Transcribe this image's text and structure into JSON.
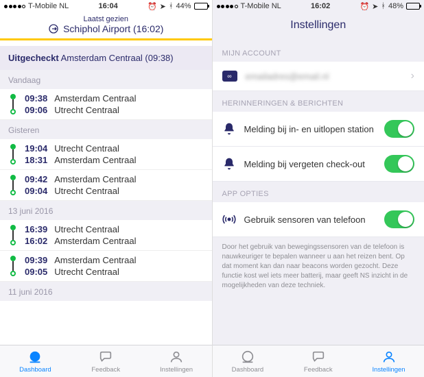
{
  "left": {
    "statusbar": {
      "carrier": "T-Mobile NL",
      "time": "16:04",
      "battery_pct": "44%",
      "battery_fill": 44
    },
    "header_label": "Laatst gezien",
    "header_location": "Schiphol Airport (16:02)",
    "status_badge": "Uitgecheckt",
    "status_text": "Amsterdam Centraal (09:38)",
    "sections": [
      {
        "title": "Vandaag",
        "trips": [
          {
            "t1": "09:38",
            "p1": "Amsterdam Centraal",
            "t2": "09:06",
            "p2": "Utrecht Centraal"
          }
        ]
      },
      {
        "title": "Gisteren",
        "trips": [
          {
            "t1": "19:04",
            "p1": "Utrecht Centraal",
            "t2": "18:31",
            "p2": "Amsterdam Centraal"
          },
          {
            "t1": "09:42",
            "p1": "Amsterdam Centraal",
            "t2": "09:04",
            "p2": "Utrecht Centraal"
          }
        ]
      },
      {
        "title": "13 juni 2016",
        "trips": [
          {
            "t1": "16:39",
            "p1": "Utrecht Centraal",
            "t2": "16:02",
            "p2": "Amsterdam Centraal"
          },
          {
            "t1": "09:39",
            "p1": "Amsterdam Centraal",
            "t2": "09:05",
            "p2": "Utrecht Centraal"
          }
        ]
      },
      {
        "title": "11 juni 2016",
        "trips": []
      }
    ],
    "tabs": {
      "dashboard": "Dashboard",
      "feedback": "Feedback",
      "settings": "Instellingen",
      "active": "dashboard"
    }
  },
  "right": {
    "statusbar": {
      "carrier": "T-Mobile NL",
      "time": "16:02",
      "battery_pct": "48%",
      "battery_fill": 48
    },
    "title": "Instellingen",
    "sections": {
      "account": {
        "label": "MIJN ACCOUNT",
        "value": "emailadres@email.nl"
      },
      "reminders": {
        "label": "HERINNERINGEN & BERICHTEN",
        "items": [
          {
            "icon": "bell",
            "label": "Melding bij in- en uitlopen station",
            "on": true
          },
          {
            "icon": "bell",
            "label": "Melding bij vergeten check-out",
            "on": true
          }
        ]
      },
      "options": {
        "label": "APP OPTIES",
        "items": [
          {
            "icon": "sensor",
            "label": "Gebruik sensoren van telefoon",
            "on": true
          }
        ],
        "note": "Door het gebruik van bewegingssensoren van de telefoon is nauwkeuriger te bepalen wanneer u aan het reizen bent. Op dat moment kan dan naar beacons worden gezocht. Deze functie kost wel iets meer batterij, maar geeft NS inzicht in de mogelijkheden van deze techniek."
      }
    },
    "tabs": {
      "dashboard": "Dashboard",
      "feedback": "Feedback",
      "settings": "Instellingen",
      "active": "settings"
    }
  }
}
